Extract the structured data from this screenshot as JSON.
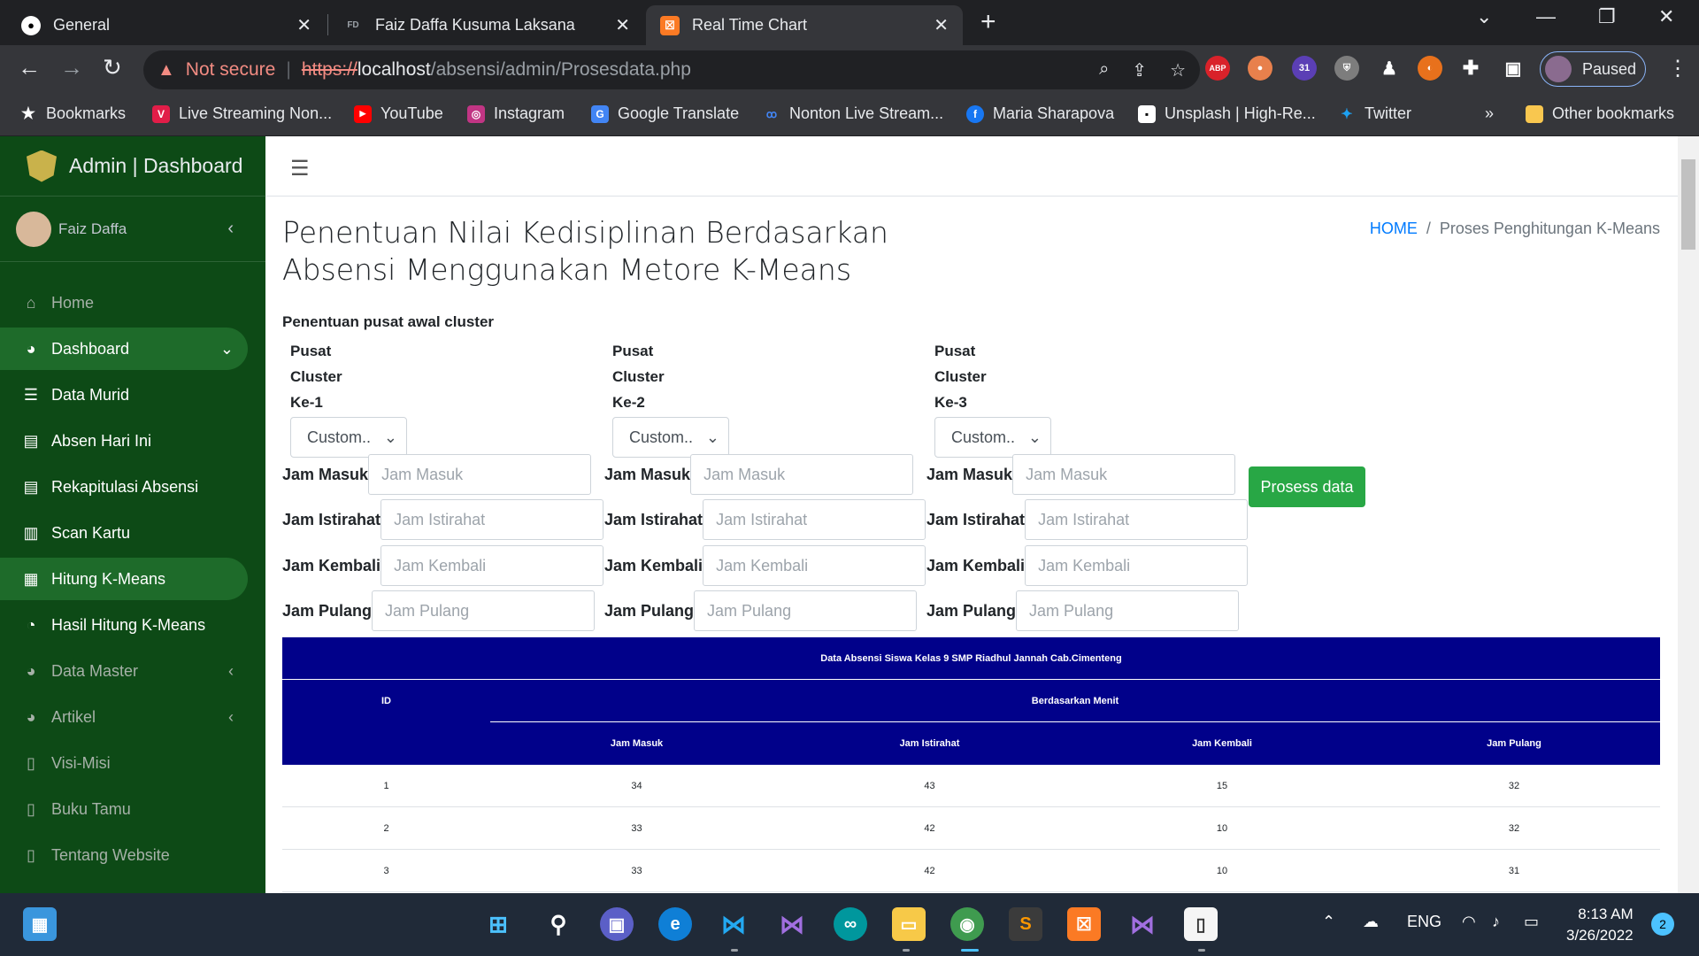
{
  "browser": {
    "tabs": [
      {
        "title": "General",
        "icon": "github-icon"
      },
      {
        "title": "Faiz Daffa Kusuma Laksana",
        "icon": "site-icon"
      },
      {
        "title": "Real Time Chart",
        "icon": "xampp-icon"
      }
    ],
    "address": {
      "security": "Not secure",
      "scheme": "https://",
      "host": "localhost",
      "path": "/absensi/admin/Prosesdata.php"
    },
    "profile_label": "Paused",
    "extension_badge": "31",
    "abp_label": "ABP",
    "bookmarks": [
      {
        "label": "Bookmarks",
        "icon": "star-icon"
      },
      {
        "label": "Live Streaming Non...",
        "icon": "vidio-icon"
      },
      {
        "label": "YouTube",
        "icon": "youtube-icon"
      },
      {
        "label": "Instagram",
        "icon": "instagram-icon"
      },
      {
        "label": "Google Translate",
        "icon": "google-translate-icon"
      },
      {
        "label": "Nonton Live Stream...",
        "icon": "stream-icon"
      },
      {
        "label": "Maria Sharapova",
        "icon": "facebook-icon"
      },
      {
        "label": "Unsplash | High-Re...",
        "icon": "unsplash-icon"
      },
      {
        "label": "Twitter",
        "icon": "twitter-icon"
      }
    ],
    "bookmarks_more": "»",
    "other_bookmarks": "Other bookmarks"
  },
  "sidebar": {
    "brand": "Admin | Dashboard",
    "user": "Faiz Daffa",
    "items": [
      {
        "label": "Home",
        "icon": "home-icon",
        "state": "dim"
      },
      {
        "label": "Dashboard",
        "icon": "dashboard-icon",
        "state": "active",
        "chevron": "⌄"
      },
      {
        "label": "Data Murid",
        "icon": "database-icon",
        "state": "normal"
      },
      {
        "label": "Absen Hari Ini",
        "icon": "book-icon",
        "state": "normal"
      },
      {
        "label": "Rekapitulasi Absensi",
        "icon": "book-icon",
        "state": "normal"
      },
      {
        "label": "Scan Kartu",
        "icon": "barcode-icon",
        "state": "normal"
      },
      {
        "label": "Hitung K-Means",
        "icon": "calculator-icon",
        "state": "active"
      },
      {
        "label": "Hasil Hitung K-Means",
        "icon": "pie-chart-icon",
        "state": "normal"
      },
      {
        "label": "Data Master",
        "icon": "dashboard-icon",
        "state": "dim",
        "chevron": "‹"
      },
      {
        "label": "Artikel",
        "icon": "dashboard-icon",
        "state": "dim",
        "chevron": "‹"
      },
      {
        "label": "Visi-Misi",
        "icon": "file-icon",
        "state": "dim"
      },
      {
        "label": "Buku Tamu",
        "icon": "file-icon",
        "state": "dim"
      },
      {
        "label": "Tentang Website",
        "icon": "file-icon",
        "state": "dim"
      }
    ]
  },
  "page": {
    "title": "Penentuan Nilai Kedisiplinan Berdasarkan Absensi Menggunakan Metore K-Means",
    "breadcrumb": {
      "home": "HOME",
      "separator": "/",
      "current": "Proses Penghitungan K-Means"
    },
    "section_label": "Penentuan pusat awal cluster",
    "clusters": [
      {
        "label_lines": [
          "Pusat",
          "Cluster",
          "Ke-1"
        ],
        "select_value": "Custom.."
      },
      {
        "label_lines": [
          "Pusat",
          "Cluster",
          "Ke-2"
        ],
        "select_value": "Custom.."
      },
      {
        "label_lines": [
          "Pusat",
          "Cluster",
          "Ke-3"
        ],
        "select_value": "Custom.."
      }
    ],
    "fields": [
      {
        "label": "Jam Masuk",
        "placeholder": "Jam Masuk"
      },
      {
        "label": "Jam Istirahat",
        "placeholder": "Jam Istirahat"
      },
      {
        "label": "Jam Kembali",
        "placeholder": "Jam Kembali"
      },
      {
        "label": "Jam Pulang",
        "placeholder": "Jam Pulang"
      }
    ],
    "process_button": "Prosess data",
    "table": {
      "caption": "Data Absensi Siswa Kelas 9 SMP Riadhul Jannah Cab.Cimenteng",
      "id_header": "ID",
      "group_header": "Berdasarkan Menit",
      "columns": [
        "Jam Masuk",
        "Jam Istirahat",
        "Jam Kembali",
        "Jam Pulang"
      ],
      "rows": [
        [
          "1",
          "34",
          "43",
          "15",
          "32"
        ],
        [
          "2",
          "33",
          "42",
          "10",
          "32"
        ],
        [
          "3",
          "33",
          "42",
          "10",
          "31"
        ]
      ]
    }
  },
  "taskbar": {
    "apps": [
      "windows-start-icon",
      "search-icon",
      "teams-icon",
      "edge-icon",
      "vscode-icon",
      "visual-studio-icon",
      "arduino-icon",
      "file-explorer-icon",
      "chrome-icon",
      "sublime-icon",
      "xampp-icon",
      "visual-studio-icon",
      "notepad-icon"
    ],
    "language": "ENG",
    "time": "8:13 AM",
    "date": "3/26/2022",
    "notifications": "2"
  },
  "colors": {
    "sidebar_bg": "#0d4a16",
    "sidebar_active": "#1e6b2a",
    "table_header": "#01018a",
    "button_green": "#28a745",
    "link_blue": "#007bff"
  }
}
